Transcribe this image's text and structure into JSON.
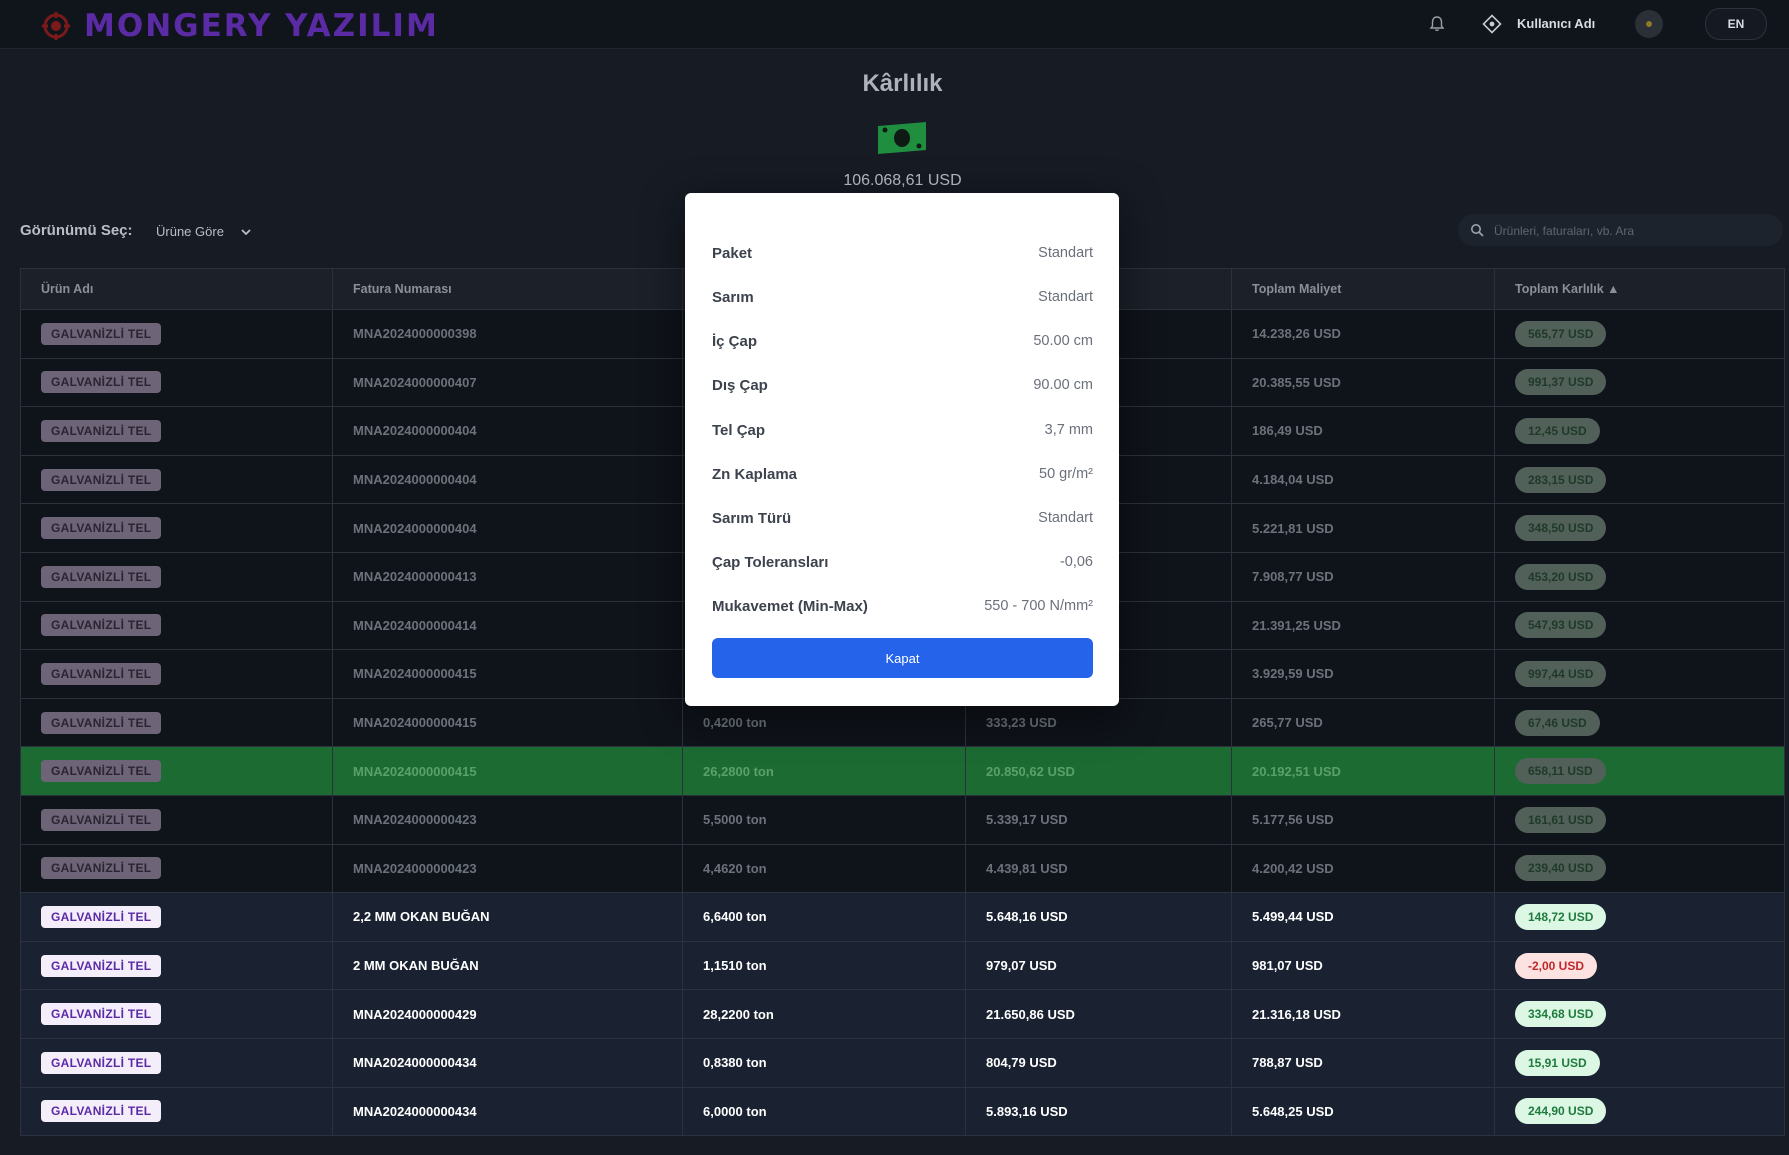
{
  "brand": {
    "name": "MONGERY YAZILIM"
  },
  "topbar": {
    "username": "Kullanıcı Adı",
    "language": "EN"
  },
  "page": {
    "title": "Kârlılık",
    "total_profit": "106.068,61 USD"
  },
  "view": {
    "label": "Görünümü Seç:",
    "selected": "Ürüne Göre"
  },
  "search": {
    "placeholder": "Ürünleri, faturaları, vb. Ara"
  },
  "table": {
    "columns": [
      "Ürün Adı",
      "Fatura Numarası",
      "",
      "",
      "Toplam Maliyet",
      "Toplam Karlılık ▲"
    ],
    "rows": [
      {
        "product": "GALVANİZLİ TEL",
        "invoice": "MNA2024000000398",
        "qty": "",
        "revenue": "",
        "cost": "14.238,26 USD",
        "profit": "565,77 USD",
        "state": "dim",
        "sign": "pos"
      },
      {
        "product": "GALVANİZLİ TEL",
        "invoice": "MNA2024000000407",
        "qty": "",
        "revenue": "",
        "cost": "20.385,55 USD",
        "profit": "991,37 USD",
        "state": "dim",
        "sign": "pos"
      },
      {
        "product": "GALVANİZLİ TEL",
        "invoice": "MNA2024000000404",
        "qty": "",
        "revenue": "",
        "cost": "186,49 USD",
        "profit": "12,45 USD",
        "state": "dim",
        "sign": "pos"
      },
      {
        "product": "GALVANİZLİ TEL",
        "invoice": "MNA2024000000404",
        "qty": "",
        "revenue": "",
        "cost": "4.184,04 USD",
        "profit": "283,15 USD",
        "state": "dim",
        "sign": "pos"
      },
      {
        "product": "GALVANİZLİ TEL",
        "invoice": "MNA2024000000404",
        "qty": "",
        "revenue": "",
        "cost": "5.221,81 USD",
        "profit": "348,50 USD",
        "state": "dim",
        "sign": "pos"
      },
      {
        "product": "GALVANİZLİ TEL",
        "invoice": "MNA2024000000413",
        "qty": "",
        "revenue": "",
        "cost": "7.908,77 USD",
        "profit": "453,20 USD",
        "state": "dim",
        "sign": "pos"
      },
      {
        "product": "GALVANİZLİ TEL",
        "invoice": "MNA2024000000414",
        "qty": "",
        "revenue": "",
        "cost": "21.391,25 USD",
        "profit": "547,93 USD",
        "state": "dim",
        "sign": "pos"
      },
      {
        "product": "GALVANİZLİ TEL",
        "invoice": "MNA2024000000415",
        "qty": "",
        "revenue": "",
        "cost": "3.929,59 USD",
        "profit": "997,44 USD",
        "state": "dim",
        "sign": "pos"
      },
      {
        "product": "GALVANİZLİ TEL",
        "invoice": "MNA2024000000415",
        "qty": "0,4200 ton",
        "revenue": "333,23 USD",
        "cost": "265,77 USD",
        "profit": "67,46 USD",
        "state": "dim",
        "sign": "pos"
      },
      {
        "product": "GALVANİZLİ TEL",
        "invoice": "MNA2024000000415",
        "qty": "26,2800 ton",
        "revenue": "20.850,62 USD",
        "cost": "20.192,51 USD",
        "profit": "658,11 USD",
        "state": "hl",
        "sign": "pos"
      },
      {
        "product": "GALVANİZLİ TEL",
        "invoice": "MNA2024000000423",
        "qty": "5,5000 ton",
        "revenue": "5.339,17 USD",
        "cost": "5.177,56 USD",
        "profit": "161,61 USD",
        "state": "dim",
        "sign": "pos"
      },
      {
        "product": "GALVANİZLİ TEL",
        "invoice": "MNA2024000000423",
        "qty": "4,4620 ton",
        "revenue": "4.439,81 USD",
        "cost": "4.200,42 USD",
        "profit": "239,40 USD",
        "state": "dim",
        "sign": "pos"
      },
      {
        "product": "GALVANİZLİ TEL",
        "invoice": "2,2 MM OKAN BUĞAN",
        "qty": "6,6400 ton",
        "revenue": "5.648,16 USD",
        "cost": "5.499,44 USD",
        "profit": "148,72 USD",
        "state": "bright",
        "sign": "pos"
      },
      {
        "product": "GALVANİZLİ TEL",
        "invoice": "2 MM OKAN BUĞAN",
        "qty": "1,1510 ton",
        "revenue": "979,07 USD",
        "cost": "981,07 USD",
        "profit": "-2,00 USD",
        "state": "bright",
        "sign": "neg"
      },
      {
        "product": "GALVANİZLİ TEL",
        "invoice": "MNA2024000000429",
        "qty": "28,2200 ton",
        "revenue": "21.650,86 USD",
        "cost": "21.316,18 USD",
        "profit": "334,68 USD",
        "state": "bright",
        "sign": "pos"
      },
      {
        "product": "GALVANİZLİ TEL",
        "invoice": "MNA2024000000434",
        "qty": "0,8380 ton",
        "revenue": "804,79 USD",
        "cost": "788,87 USD",
        "profit": "15,91 USD",
        "state": "bright",
        "sign": "pos"
      },
      {
        "product": "GALVANİZLİ TEL",
        "invoice": "MNA2024000000434",
        "qty": "6,0000 ton",
        "revenue": "5.893,16 USD",
        "cost": "5.648,25 USD",
        "profit": "244,90 USD",
        "state": "bright",
        "sign": "pos"
      }
    ]
  },
  "modal": {
    "rows": [
      {
        "key": "Paket",
        "value": "Standart"
      },
      {
        "key": "Sarım",
        "value": "Standart"
      },
      {
        "key": "İç Çap",
        "value": "50.00 cm"
      },
      {
        "key": "Dış Çap",
        "value": "90.00 cm"
      },
      {
        "key": "Tel Çap",
        "value": "3,7 mm"
      },
      {
        "key": "Zn Kaplama",
        "value": "50 gr/m²"
      },
      {
        "key": "Sarım Türü",
        "value": "Standart"
      },
      {
        "key": "Çap Toleransları",
        "value": "-0,06"
      },
      {
        "key": "Mukavemet (Min-Max)",
        "value": "550 - 700 N/mm²"
      }
    ],
    "close_label": "Kapat"
  },
  "colors": {
    "brand": "#5b2ba6",
    "primary_button": "#2563eb",
    "highlight_row": "#1c6b33",
    "money_icon": "#1f8f3f"
  },
  "icons": [
    "logo-mark-icon",
    "bell-icon",
    "user-settings-icon",
    "money-icon",
    "chevron-down-icon",
    "search-icon"
  ]
}
